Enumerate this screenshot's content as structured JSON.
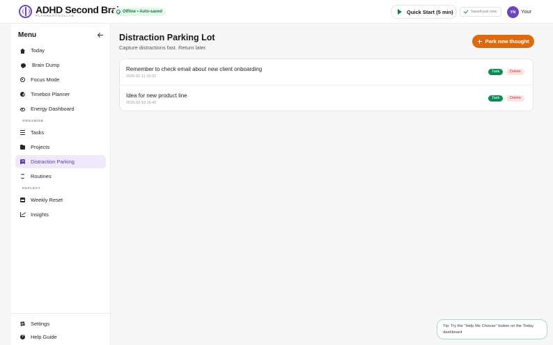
{
  "header": {
    "brand_title": "ADHD Second Brain",
    "brand_subtitle": "PLANNERTOOLLAB",
    "status": "Offline • Auto-saved",
    "quick_start_label": "Quick Start (5 min)",
    "saved_status": "Saved just now",
    "user_initials": "YN",
    "user_name": "Your"
  },
  "sidebar": {
    "menu_title": "Menu",
    "primary_items": [
      {
        "label": "Today",
        "icon": "home-icon"
      },
      {
        "label": "Brain Dump",
        "icon": "lightbulb-icon"
      },
      {
        "label": "Focus Mode",
        "icon": "target-icon"
      },
      {
        "label": "Timebox Planner",
        "icon": "clock-icon"
      },
      {
        "label": "Energy Dashboard",
        "icon": "toggle-icon"
      }
    ],
    "organise_label": "ORGANISE",
    "organise_items": [
      {
        "label": "Tasks",
        "icon": "list-icon"
      },
      {
        "label": "Projects",
        "icon": "folder-icon"
      },
      {
        "label": "Distraction Parking",
        "icon": "note-icon",
        "active": true
      },
      {
        "label": "Routines",
        "icon": "refresh-icon"
      }
    ],
    "reflect_label": "REFLECT",
    "reflect_items": [
      {
        "label": "Weekly Reset",
        "icon": "calendar-icon"
      },
      {
        "label": "Insights",
        "icon": "chart-icon"
      }
    ],
    "footer_items": [
      {
        "label": "Settings",
        "icon": "gear-icon"
      },
      {
        "label": "Help Guide",
        "icon": "help-icon"
      }
    ]
  },
  "main": {
    "title": "Distraction Parking Lot",
    "subtitle": "Capture distractions fast. Return later.",
    "park_button_label": "Park new thought",
    "thoughts": [
      {
        "text": "Remember to check email about new client onboarding",
        "timestamp": "2026-02-11 10:22",
        "task_label": "Task",
        "delete_label": "Delete"
      },
      {
        "text": "Idea for new product line",
        "timestamp": "2026-02-10 16:40",
        "task_label": "Task",
        "delete_label": "Delete"
      }
    ]
  },
  "tip": {
    "text": "Tip: Try the \"Help Me Choose\" button on the Today dashboard"
  },
  "colors": {
    "accent": "#6b46c1",
    "primary_action": "#dd6b0e",
    "success": "#0f8a55",
    "danger": "#c03434"
  }
}
